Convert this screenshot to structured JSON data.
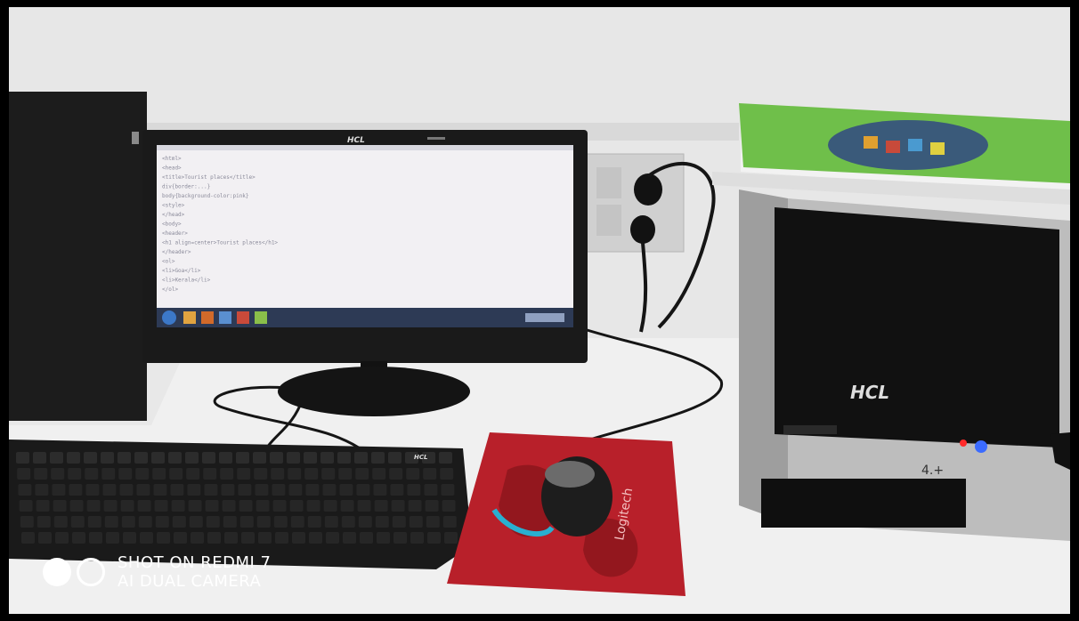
{
  "watermark": {
    "line1": "SHOT ON REDMI 7",
    "line2": "AI DUAL CAMERA"
  },
  "monitor": {
    "brand": "HCL",
    "code_lines": [
      "<html>",
      "<head>",
      "<title>Tourist places</title>",
      "div{border:...}",
      "body{background-color:pink}",
      "<style>",
      "</head>",
      "<body>",
      "<header>",
      "<h1 align=center>Tourist places</h1>",
      "</header>",
      "<ol>",
      "<li>Goa</li>",
      "<li>Kerala</li>",
      "</ol>"
    ]
  },
  "cpu": {
    "brand": "HCL",
    "handwriting": "4.+"
  },
  "mousepad": {
    "brand_text": "Logitech"
  },
  "colors": {
    "wall": "#e6e6e6",
    "desk": "#efefef",
    "monitor_body": "#1a1a1a",
    "screen": "#f2f0f3",
    "cpu_silver": "#bdbdbd",
    "cpu_front": "#111111",
    "book_green": "#6fbf4a",
    "mousepad_red": "#b8202a",
    "led_red": "#ff2a2a",
    "led_blue": "#3b6bff"
  }
}
